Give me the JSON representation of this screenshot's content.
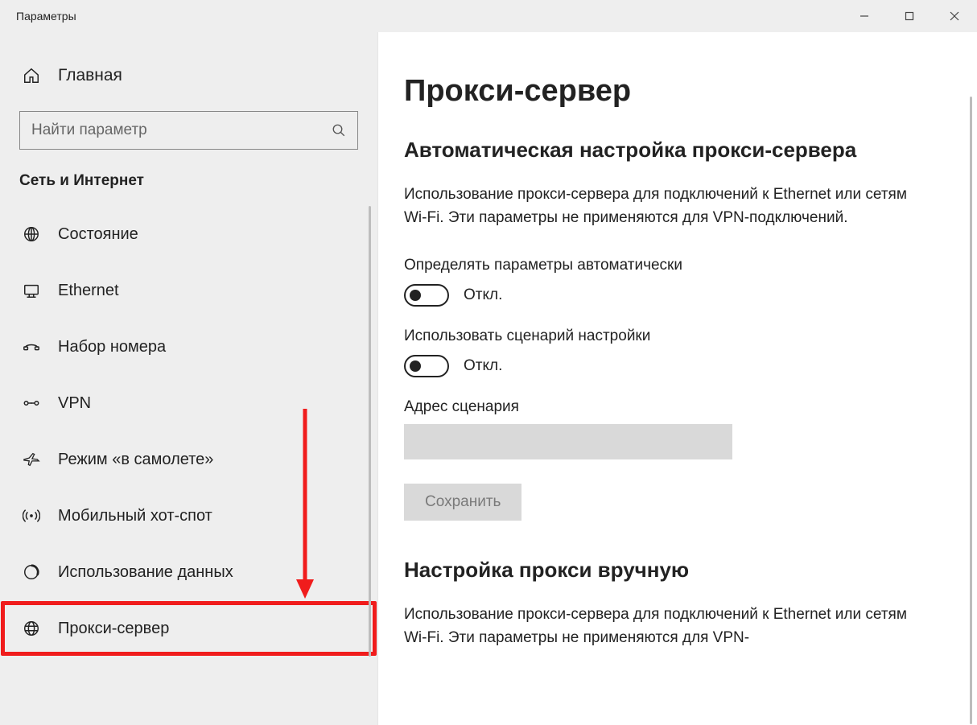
{
  "window": {
    "title": "Параметры"
  },
  "sidebar": {
    "home_label": "Главная",
    "search_placeholder": "Найти параметр",
    "section": "Сеть и Интернет",
    "items": [
      {
        "id": "status",
        "label": "Состояние"
      },
      {
        "id": "ethernet",
        "label": "Ethernet"
      },
      {
        "id": "dialup",
        "label": "Набор номера"
      },
      {
        "id": "vpn",
        "label": "VPN"
      },
      {
        "id": "airplane",
        "label": "Режим «в самолете»"
      },
      {
        "id": "hotspot",
        "label": "Мобильный хот-спот"
      },
      {
        "id": "datausage",
        "label": "Использование данных"
      },
      {
        "id": "proxy",
        "label": "Прокси-сервер"
      }
    ]
  },
  "main": {
    "page_title": "Прокси-сервер",
    "auto": {
      "heading": "Автоматическая настройка прокси-сервера",
      "description": "Использование прокси-сервера для подключений к Ethernet или сетям Wi-Fi. Эти параметры не применяются для VPN-подключений.",
      "detect_label": "Определять параметры автоматически",
      "detect_state": "Откл.",
      "script_label": "Использовать сценарий настройки",
      "script_state": "Откл.",
      "script_addr_label": "Адрес сценария",
      "script_addr_value": "",
      "save_button": "Сохранить"
    },
    "manual": {
      "heading": "Настройка прокси вручную",
      "description": "Использование прокси-сервера для подключений к Ethernet или сетям Wi-Fi. Эти параметры не применяются для VPN-"
    }
  }
}
